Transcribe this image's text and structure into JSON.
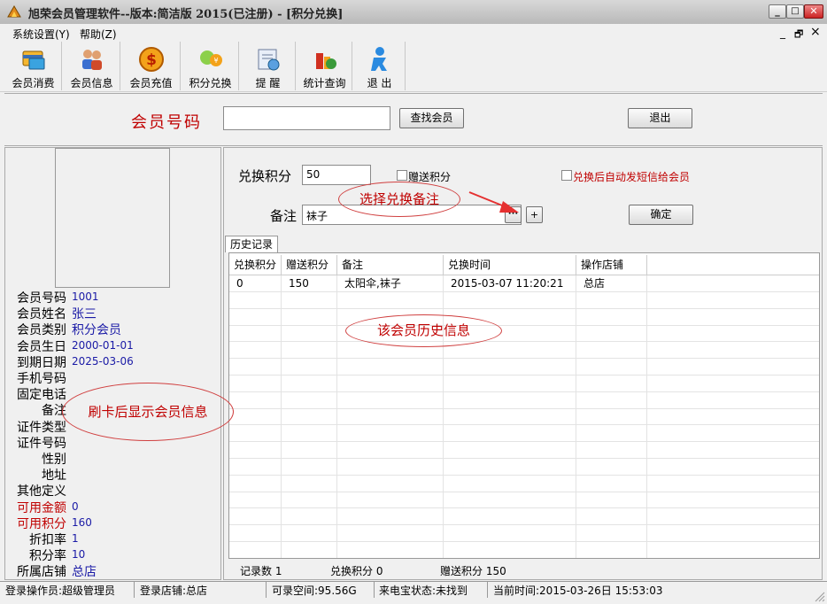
{
  "window": {
    "title": "旭荣会员管理软件--版本:简洁版  2015(已注册)  -  [积分兑换]",
    "minimize": "_",
    "maximize": "□",
    "close": "✕"
  },
  "menu": {
    "items": [
      "系统设置(Y)",
      "帮助(Z)"
    ],
    "mdi": [
      "_",
      "🗗",
      "×"
    ]
  },
  "toolbar": {
    "buttons": [
      {
        "label": "会员消费",
        "icon": "card-icon"
      },
      {
        "label": "会员信息",
        "icon": "users-icon"
      },
      {
        "label": "会员充值",
        "icon": "coin-icon"
      },
      {
        "label": "积分兑换",
        "icon": "exchange-icon"
      },
      {
        "label": "提  醒",
        "icon": "reminder-icon"
      },
      {
        "label": "统计查询",
        "icon": "stats-icon"
      },
      {
        "label": "退  出",
        "icon": "exit-icon"
      }
    ]
  },
  "search": {
    "label": "会员号码",
    "value": "",
    "find_button": "查找会员",
    "exit_button": "退出"
  },
  "member": {
    "fields": [
      {
        "label": "会员号码",
        "value": "1001",
        "red": false
      },
      {
        "label": "会员姓名",
        "value": "张三",
        "red": false,
        "big": true
      },
      {
        "label": "会员类别",
        "value": "积分会员",
        "red": false,
        "big": true
      },
      {
        "label": "会员生日",
        "value": "2000-01-01",
        "red": false
      },
      {
        "label": "到期日期",
        "value": "2025-03-06",
        "red": false
      },
      {
        "label": "手机号码",
        "value": "",
        "red": false
      },
      {
        "label": "固定电话",
        "value": "",
        "red": false
      },
      {
        "label": "备注",
        "value": "",
        "red": false
      },
      {
        "label": "证件类型",
        "value": "",
        "red": false
      },
      {
        "label": "证件号码",
        "value": "",
        "red": false
      },
      {
        "label": "性别",
        "value": "",
        "red": false
      },
      {
        "label": "地址",
        "value": "",
        "red": false
      },
      {
        "label": "其他定义",
        "value": "",
        "red": false
      },
      {
        "label": "可用金额",
        "value": "0",
        "red": true
      },
      {
        "label": "可用积分",
        "value": "160",
        "red": true
      },
      {
        "label": "折扣率",
        "value": "1",
        "red": false
      },
      {
        "label": "积分率",
        "value": "10",
        "red": false
      },
      {
        "label": "所属店铺",
        "value": "总店",
        "red": false,
        "big": true
      }
    ]
  },
  "exchange": {
    "points_label": "兑换积分",
    "points_value": "50",
    "gift_label": "赠送积分",
    "sms_label": "兑换后自动发短信给会员",
    "remark_label": "备注",
    "remark_value": "袜子",
    "browse_button": "···",
    "add_button": "+",
    "confirm_button": "确定"
  },
  "history": {
    "tab": "历史记录",
    "columns": [
      "兑换积分",
      "赠送积分",
      "备注",
      "兑换时间",
      "操作店铺"
    ],
    "rows": [
      [
        "0",
        "150",
        "太阳伞,袜子",
        "2015-03-07 11:20:21",
        "总店"
      ]
    ],
    "summary": {
      "records": "记录数 1",
      "points": "兑换积分 0",
      "gift": "赠送积分 150"
    }
  },
  "annotations": {
    "select_remark": "选择兑换备注",
    "history_info": "该会员历史信息",
    "card_info": "刷卡后显示会员信息"
  },
  "status": {
    "operator": "登录操作员:超级管理员",
    "store": "登录店铺:总店",
    "space": "可录空间:95.56G",
    "caller": "来电宝状态:未找到",
    "time": "当前时间:2015-03-26日  15:53:03"
  },
  "colors": {
    "accent_red": "#c00000",
    "value_blue": "#1a1aa6",
    "annotation_red": "#d04040"
  }
}
